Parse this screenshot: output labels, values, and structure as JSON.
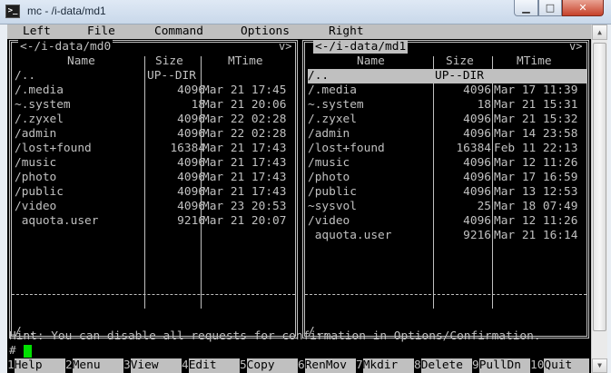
{
  "window": {
    "title": "mc - /i-data/md1",
    "background_text": "",
    "controls": {
      "minimize": "▁",
      "maximize": "□",
      "close": "✕"
    }
  },
  "menu": [
    "Left",
    "File",
    "Command",
    "Options",
    "Right"
  ],
  "left_panel": {
    "path": "<-/i-data/md0",
    "corner": "v>",
    "columns": [
      "Name",
      "Size",
      "MTime"
    ],
    "rows": [
      {
        "name": "/..",
        "size": "UP--DIR",
        "mtime": ""
      },
      {
        "name": "/.media",
        "size": "4096",
        "mtime": "Mar 21 17:45"
      },
      {
        "name": "~.system",
        "size": "18",
        "mtime": "Mar 21 20:06"
      },
      {
        "name": "/.zyxel",
        "size": "4096",
        "mtime": "Mar 22 02:28"
      },
      {
        "name": "/admin",
        "size": "4096",
        "mtime": "Mar 22 02:28"
      },
      {
        "name": "/lost+found",
        "size": "16384",
        "mtime": "Mar 21 17:43"
      },
      {
        "name": "/music",
        "size": "4096",
        "mtime": "Mar 21 17:43"
      },
      {
        "name": "/photo",
        "size": "4096",
        "mtime": "Mar 21 17:43"
      },
      {
        "name": "/public",
        "size": "4096",
        "mtime": "Mar 21 17:43"
      },
      {
        "name": "/video",
        "size": "4096",
        "mtime": "Mar 23 20:53"
      },
      {
        "name": " aquota.user",
        "size": "9216",
        "mtime": "Mar 21 20:07"
      }
    ],
    "mini_status": "/.."
  },
  "right_panel": {
    "path": "<-/i-data/md1",
    "corner": "v>",
    "columns": [
      "Name",
      "Size",
      "MTime"
    ],
    "rows": [
      {
        "name": "/..",
        "size": "UP--DIR",
        "mtime": "",
        "selected": true
      },
      {
        "name": "/.media",
        "size": "4096",
        "mtime": "Mar 17 11:39"
      },
      {
        "name": "~.system",
        "size": "18",
        "mtime": "Mar 21 15:31"
      },
      {
        "name": "/.zyxel",
        "size": "4096",
        "mtime": "Mar 21 15:32"
      },
      {
        "name": "/admin",
        "size": "4096",
        "mtime": "Mar 14 23:58"
      },
      {
        "name": "/lost+found",
        "size": "16384",
        "mtime": "Feb 11 22:13"
      },
      {
        "name": "/music",
        "size": "4096",
        "mtime": "Mar 12 11:26"
      },
      {
        "name": "/photo",
        "size": "4096",
        "mtime": "Mar 17 16:59"
      },
      {
        "name": "/public",
        "size": "4096",
        "mtime": "Mar 13 12:53"
      },
      {
        "name": "~sysvol",
        "size": "25",
        "mtime": "Mar 18 07:49"
      },
      {
        "name": "/video",
        "size": "4096",
        "mtime": "Mar 12 11:26"
      },
      {
        "name": " aquota.user",
        "size": "9216",
        "mtime": "Mar 21 16:14"
      }
    ],
    "mini_status": "/.."
  },
  "hint": "Hint: You can disable all requests for confirmation in Options/Confirmation.",
  "prompt": "#",
  "fkeys": [
    {
      "num": "1",
      "label": "Help"
    },
    {
      "num": "2",
      "label": "Menu"
    },
    {
      "num": "3",
      "label": "View"
    },
    {
      "num": "4",
      "label": "Edit"
    },
    {
      "num": "5",
      "label": "Copy"
    },
    {
      "num": "6",
      "label": "RenMov"
    },
    {
      "num": "7",
      "label": "Mkdir"
    },
    {
      "num": "8",
      "label": "Delete"
    },
    {
      "num": "9",
      "label": "PullDn"
    },
    {
      "num": "10",
      "label": "Quit"
    }
  ],
  "colors": {
    "terminal_bg": "#000000",
    "terminal_fg": "#c0c0c0",
    "cursor": "#00e000",
    "titlebar": "#c9d8ea"
  }
}
